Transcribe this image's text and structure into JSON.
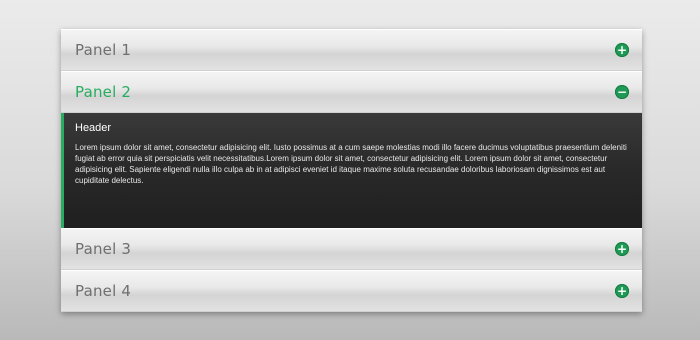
{
  "accordion": {
    "panels": [
      {
        "title": "Panel 1",
        "toggle": "+"
      },
      {
        "title": "Panel 2",
        "toggle": "−"
      },
      {
        "title": "Panel 3",
        "toggle": "+"
      },
      {
        "title": "Panel 4",
        "toggle": "+"
      }
    ],
    "active_content": {
      "header": "Header",
      "body": "Lorem ipsum dolor sit amet, consectetur adipisicing elit. Iusto possimus at a cum saepe molestias modi illo facere ducimus voluptatibus praesentium deleniti fugiat ab error quia sit perspiciatis velit necessitatibus.Lorem ipsum dolor sit amet, consectetur adipisicing elit. Lorem ipsum dolor sit amet, consectetur adipisicing elit. Sapiente eligendi nulla illo culpa ab in at adipisci eveniet id itaque maxime soluta recusandae doloribus laboriosam dignissimos est aut cupiditate delectus."
    },
    "icons": {
      "expand": "plus-circle-icon",
      "collapse": "minus-circle-icon"
    },
    "colors": {
      "accent": "#27ad5f",
      "toggle_bg": "#1f9a55",
      "content_bg": "#2a2a2a"
    }
  }
}
